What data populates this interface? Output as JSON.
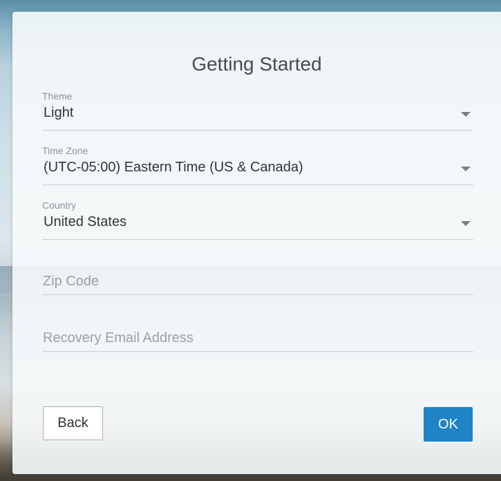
{
  "dialog": {
    "title": "Getting Started"
  },
  "theme": {
    "label": "Theme",
    "value": "Light"
  },
  "time_zone": {
    "label": "Time Zone",
    "value": "(UTC-05:00) Eastern Time (US & Canada)"
  },
  "country": {
    "label": "Country",
    "value": "United States"
  },
  "zip_code": {
    "placeholder": "Zip Code",
    "value": ""
  },
  "recovery_email": {
    "placeholder": "Recovery Email Address",
    "value": ""
  },
  "buttons": {
    "back_label": "Back",
    "ok_label": "OK"
  },
  "colors": {
    "primary": "#1f84c6",
    "divider": "#c9cfd3"
  }
}
